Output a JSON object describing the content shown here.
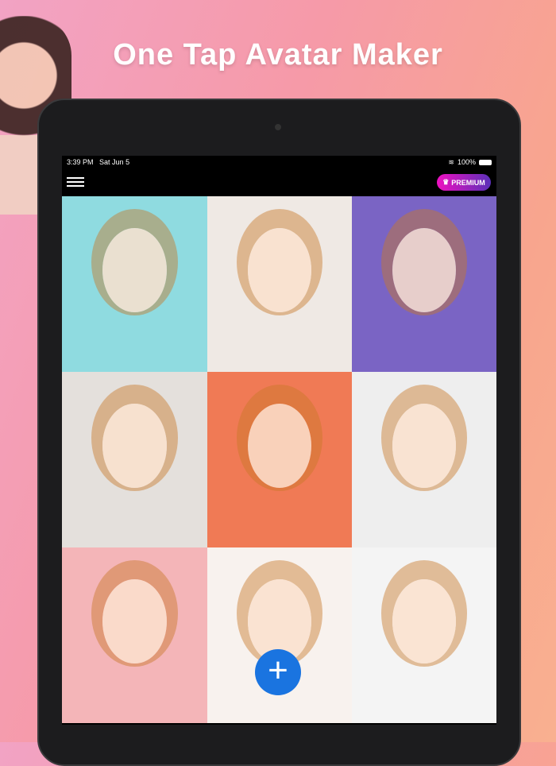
{
  "promo_title": "One Tap Avatar Maker",
  "status_bar": {
    "time": "3:39 PM",
    "date": "Sat Jun 5",
    "battery": "100%"
  },
  "nav": {
    "premium_label": "PREMIUM",
    "crown_icon": "♛",
    "wifi_icon": "≋"
  },
  "gallery": [
    {
      "bg": "#8fdbe0"
    },
    {
      "bg": "#efe9e4"
    },
    {
      "bg": "#7a64c4"
    },
    {
      "bg": "#e4e0dc"
    },
    {
      "bg": "#f07a55"
    },
    {
      "bg": "#eeeeee"
    },
    {
      "bg": "#f4b5b8"
    },
    {
      "bg": "#f8f2ee"
    },
    {
      "bg": "#f4f4f4"
    }
  ],
  "fab": {
    "label": "+"
  }
}
